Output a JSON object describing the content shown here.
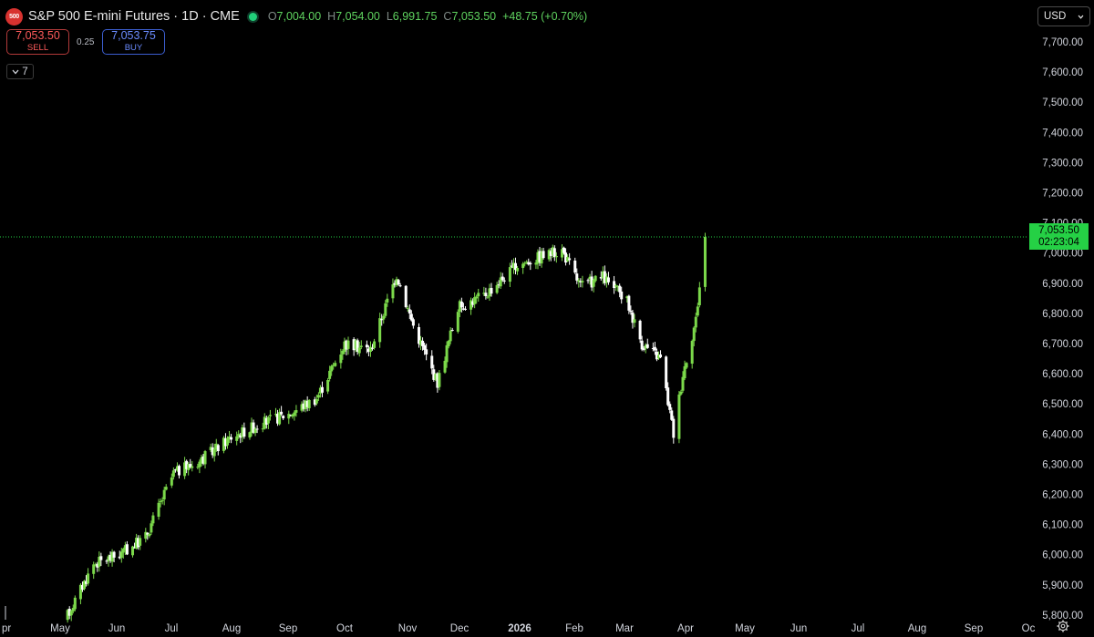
{
  "header": {
    "logo_text": "500",
    "title": "S&P 500 E-mini Futures · 1D · CME",
    "open_label": "O",
    "open": "7,004.00",
    "high_label": "H",
    "high": "7,054.00",
    "low_label": "L",
    "low": "6,991.75",
    "close_label": "C",
    "close": "7,053.50",
    "change": "+48.75 (+0.70%)"
  },
  "trade": {
    "sell_price": "7,053.50",
    "sell_label": "SELL",
    "spread": "0.25",
    "buy_price": "7,053.75",
    "buy_label": "BUY"
  },
  "indicators_toggle": {
    "icon": "chevron-down-icon",
    "count": "7"
  },
  "currency": {
    "selected": "USD"
  },
  "last_price": {
    "price": "7,053.50",
    "countdown": "02:23:04"
  },
  "price_axis_labels": [
    "7,700.00",
    "7,600.00",
    "7,500.00",
    "7,400.00",
    "7,300.00",
    "7,200.00",
    "7,100.00",
    "7,000.00",
    "6,900.00",
    "6,800.00",
    "6,700.00",
    "6,600.00",
    "6,500.00",
    "6,400.00",
    "6,300.00",
    "6,200.00",
    "6,100.00",
    "6,000.00",
    "5,900.00",
    "5,800.00"
  ],
  "time_axis_labels": [
    "pr",
    "May",
    "Jun",
    "Jul",
    "Aug",
    "Sep",
    "Oct",
    "Nov",
    "Dec",
    "2026",
    "Feb",
    "Mar",
    "Apr",
    "May",
    "Jun",
    "Jul",
    "Aug",
    "Sep",
    "Oc"
  ],
  "colors": {
    "up": "#7bd84a",
    "down": "#ffffff",
    "last_price": "#25d045",
    "background": "#000000"
  },
  "chart_data": {
    "type": "line",
    "title": "S&P 500 E-mini Futures · 1D · CME",
    "series": [
      {
        "name": "",
        "x": [
          "2025-05-05",
          "2025-05-19",
          "2025-06-02",
          "2025-06-16",
          "2025-07-01",
          "2025-07-15",
          "2025-08-01",
          "2025-08-15",
          "2025-09-02",
          "2025-09-16",
          "2025-10-01",
          "2025-10-15",
          "2025-10-29",
          "2025-11-07",
          "2025-11-20",
          "2025-12-01",
          "2025-12-15",
          "2026-01-02",
          "2026-01-15",
          "2026-01-26",
          "2026-02-05",
          "2026-02-17",
          "2026-03-02",
          "2026-03-10",
          "2026-03-20",
          "2026-03-27",
          "2026-04-01",
          "2026-04-08",
          "2026-04-13"
        ],
        "values": [
          5800,
          5970,
          6000,
          6060,
          6270,
          6310,
          6390,
          6430,
          6470,
          6520,
          6700,
          6680,
          6930,
          6760,
          6570,
          6820,
          6860,
          6960,
          6990,
          7010,
          6890,
          6920,
          6840,
          6700,
          6650,
          6400,
          6600,
          6780,
          7053.5
        ]
      }
    ],
    "ylim": [
      5750,
      7750
    ],
    "last_value": 7053.5
  }
}
